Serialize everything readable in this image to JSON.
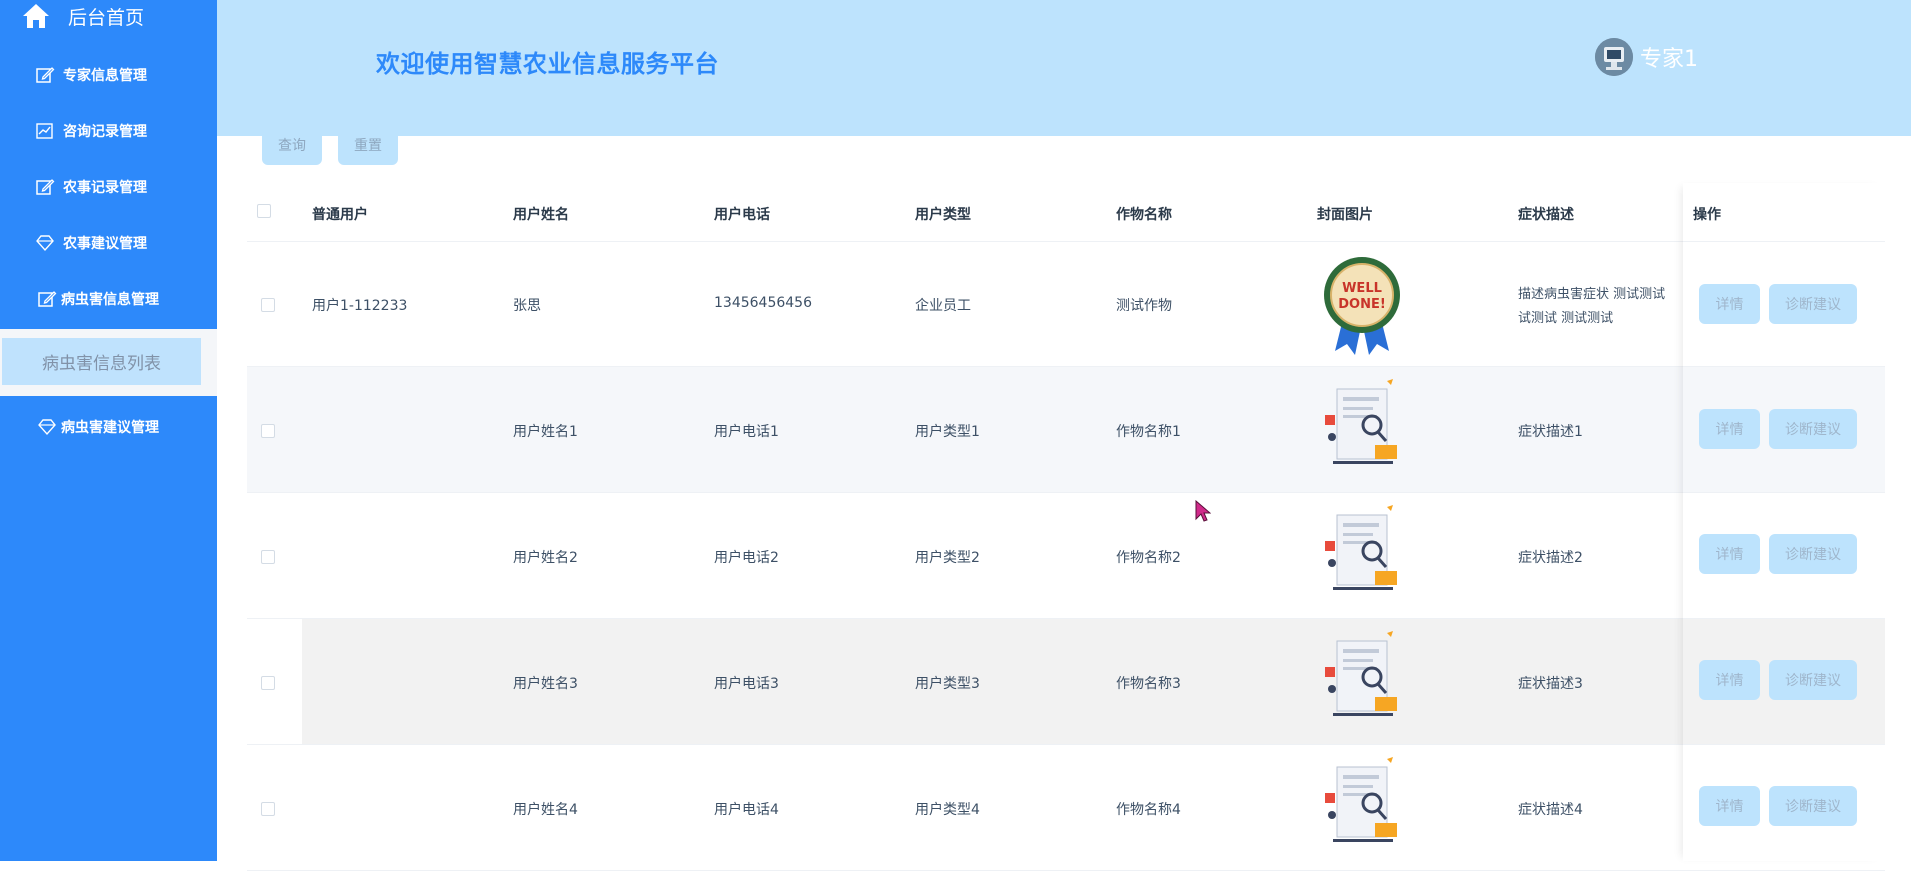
{
  "sidebar": {
    "home_label": "后台首页",
    "items": [
      {
        "label": "专家信息管理",
        "icon": "edit-icon"
      },
      {
        "label": "咨询记录管理",
        "icon": "chart-icon"
      },
      {
        "label": "农事记录管理",
        "icon": "edit-icon"
      },
      {
        "label": "农事建议管理",
        "icon": "diamond-icon"
      },
      {
        "label": "病虫害信息管理",
        "icon": "edit-icon"
      },
      {
        "label": "病虫害建议管理",
        "icon": "diamond-icon"
      }
    ],
    "active_subitem": "病虫害信息列表",
    "colors": {
      "bg": "#2d89fa",
      "active_bg": "#bfe2fd"
    }
  },
  "header": {
    "title": "欢迎使用智慧农业信息服务平台",
    "user_name": "专家1",
    "bg": "#bde3fd"
  },
  "toolbar": {
    "query_label": "查询",
    "reset_label": "重置"
  },
  "table": {
    "columns": [
      "普通用户",
      "用户姓名",
      "用户电话",
      "用户类型",
      "作物名称",
      "封面图片",
      "症状描述",
      "操作"
    ],
    "rows": [
      {
        "user": "用户1-112233",
        "name": "张思",
        "phone": "13456456456",
        "type": "企业员工",
        "crop": "测试作物",
        "image": "well-done-badge",
        "symptom_line1": "描述病虫害症状 测试测试",
        "symptom_line2": "试测试 测试测试"
      },
      {
        "user": "",
        "name": "用户姓名1",
        "phone": "用户电话1",
        "type": "用户类型1",
        "crop": "作物名称1",
        "image": "document-illustration",
        "symptom_line1": "症状描述1",
        "symptom_line2": ""
      },
      {
        "user": "",
        "name": "用户姓名2",
        "phone": "用户电话2",
        "type": "用户类型2",
        "crop": "作物名称2",
        "image": "document-illustration",
        "symptom_line1": "症状描述2",
        "symptom_line2": ""
      },
      {
        "user": "",
        "name": "用户姓名3",
        "phone": "用户电话3",
        "type": "用户类型3",
        "crop": "作物名称3",
        "image": "document-illustration",
        "symptom_line1": "症状描述3",
        "symptom_line2": ""
      },
      {
        "user": "",
        "name": "用户姓名4",
        "phone": "用户电话4",
        "type": "用户类型4",
        "crop": "作物名称4",
        "image": "document-illustration",
        "symptom_line1": "症状描述4",
        "symptom_line2": ""
      }
    ],
    "action_detail": "详情",
    "action_advice": "诊断建议"
  }
}
